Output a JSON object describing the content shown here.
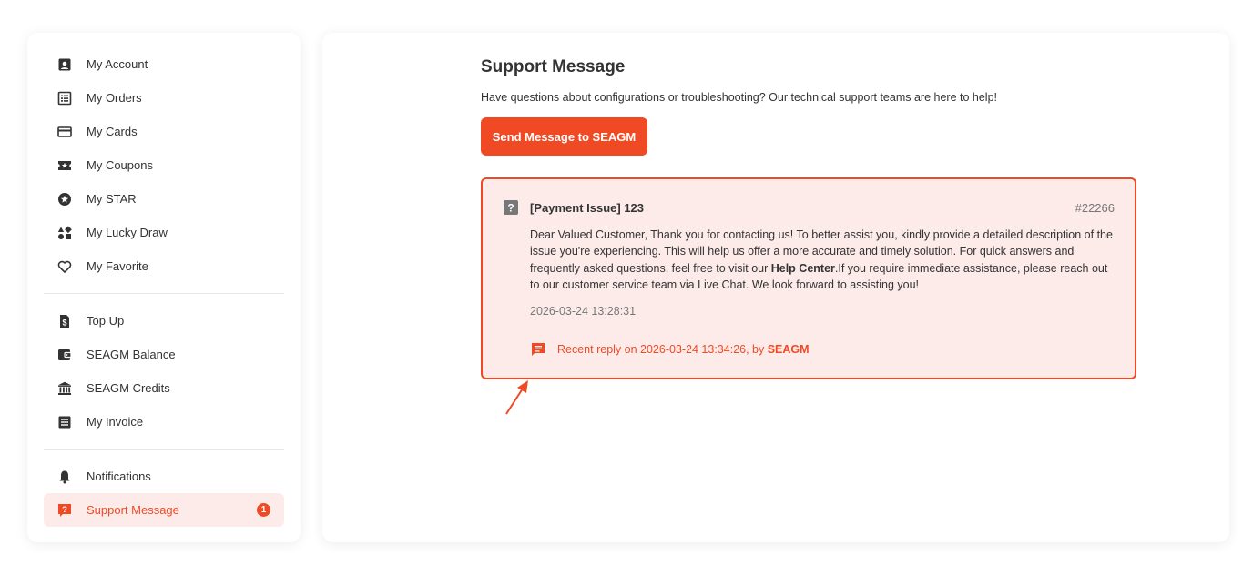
{
  "sidebar": {
    "group1": [
      {
        "label": "My Account",
        "icon": "account-box-icon"
      },
      {
        "label": "My Orders",
        "icon": "list-box-icon"
      },
      {
        "label": "My Cards",
        "icon": "credit-card-icon"
      },
      {
        "label": "My Coupons",
        "icon": "coupon-ticket-icon"
      },
      {
        "label": "My STAR",
        "icon": "star-circle-icon"
      },
      {
        "label": "My Lucky Draw",
        "icon": "shapes-icon"
      },
      {
        "label": "My Favorite",
        "icon": "heart-icon"
      }
    ],
    "group2": [
      {
        "label": "Top Up",
        "icon": "dollar-doc-icon"
      },
      {
        "label": "SEAGM Balance",
        "icon": "wallet-icon"
      },
      {
        "label": "SEAGM Credits",
        "icon": "bank-icon"
      },
      {
        "label": "My Invoice",
        "icon": "invoice-icon"
      }
    ],
    "group3": [
      {
        "label": "Notifications",
        "icon": "bell-icon"
      },
      {
        "label": "Support Message",
        "icon": "support-question-icon",
        "badge": "1",
        "active": true
      }
    ]
  },
  "main": {
    "title": "Support Message",
    "description": "Have questions about configurations or troubleshooting? Our technical support teams are here to help!",
    "send_button": "Send Message to SEAGM",
    "ticket": {
      "subject": "[Payment Issue] 123",
      "id": "#22266",
      "body_part1": "Dear Valued Customer, Thank you for contacting us!  To better assist you, kindly provide a detailed description of the issue you're experiencing. This will help us offer a more accurate and timely solution.  For quick answers and frequently asked questions, feel free to visit our ",
      "body_link": "Help Center",
      "body_part2": ".If you require immediate assistance, please reach out to our customer service team via Live Chat.  We look forward to assisting you!",
      "date": "2026-03-24 13:28:31",
      "reply_prefix": "Recent reply on 2026-03-24 13:34:26, by ",
      "reply_author": "SEAGM"
    }
  },
  "colors": {
    "accent": "#f04a24",
    "active_bg": "#fdebea",
    "text": "#333333",
    "muted": "#777777"
  }
}
